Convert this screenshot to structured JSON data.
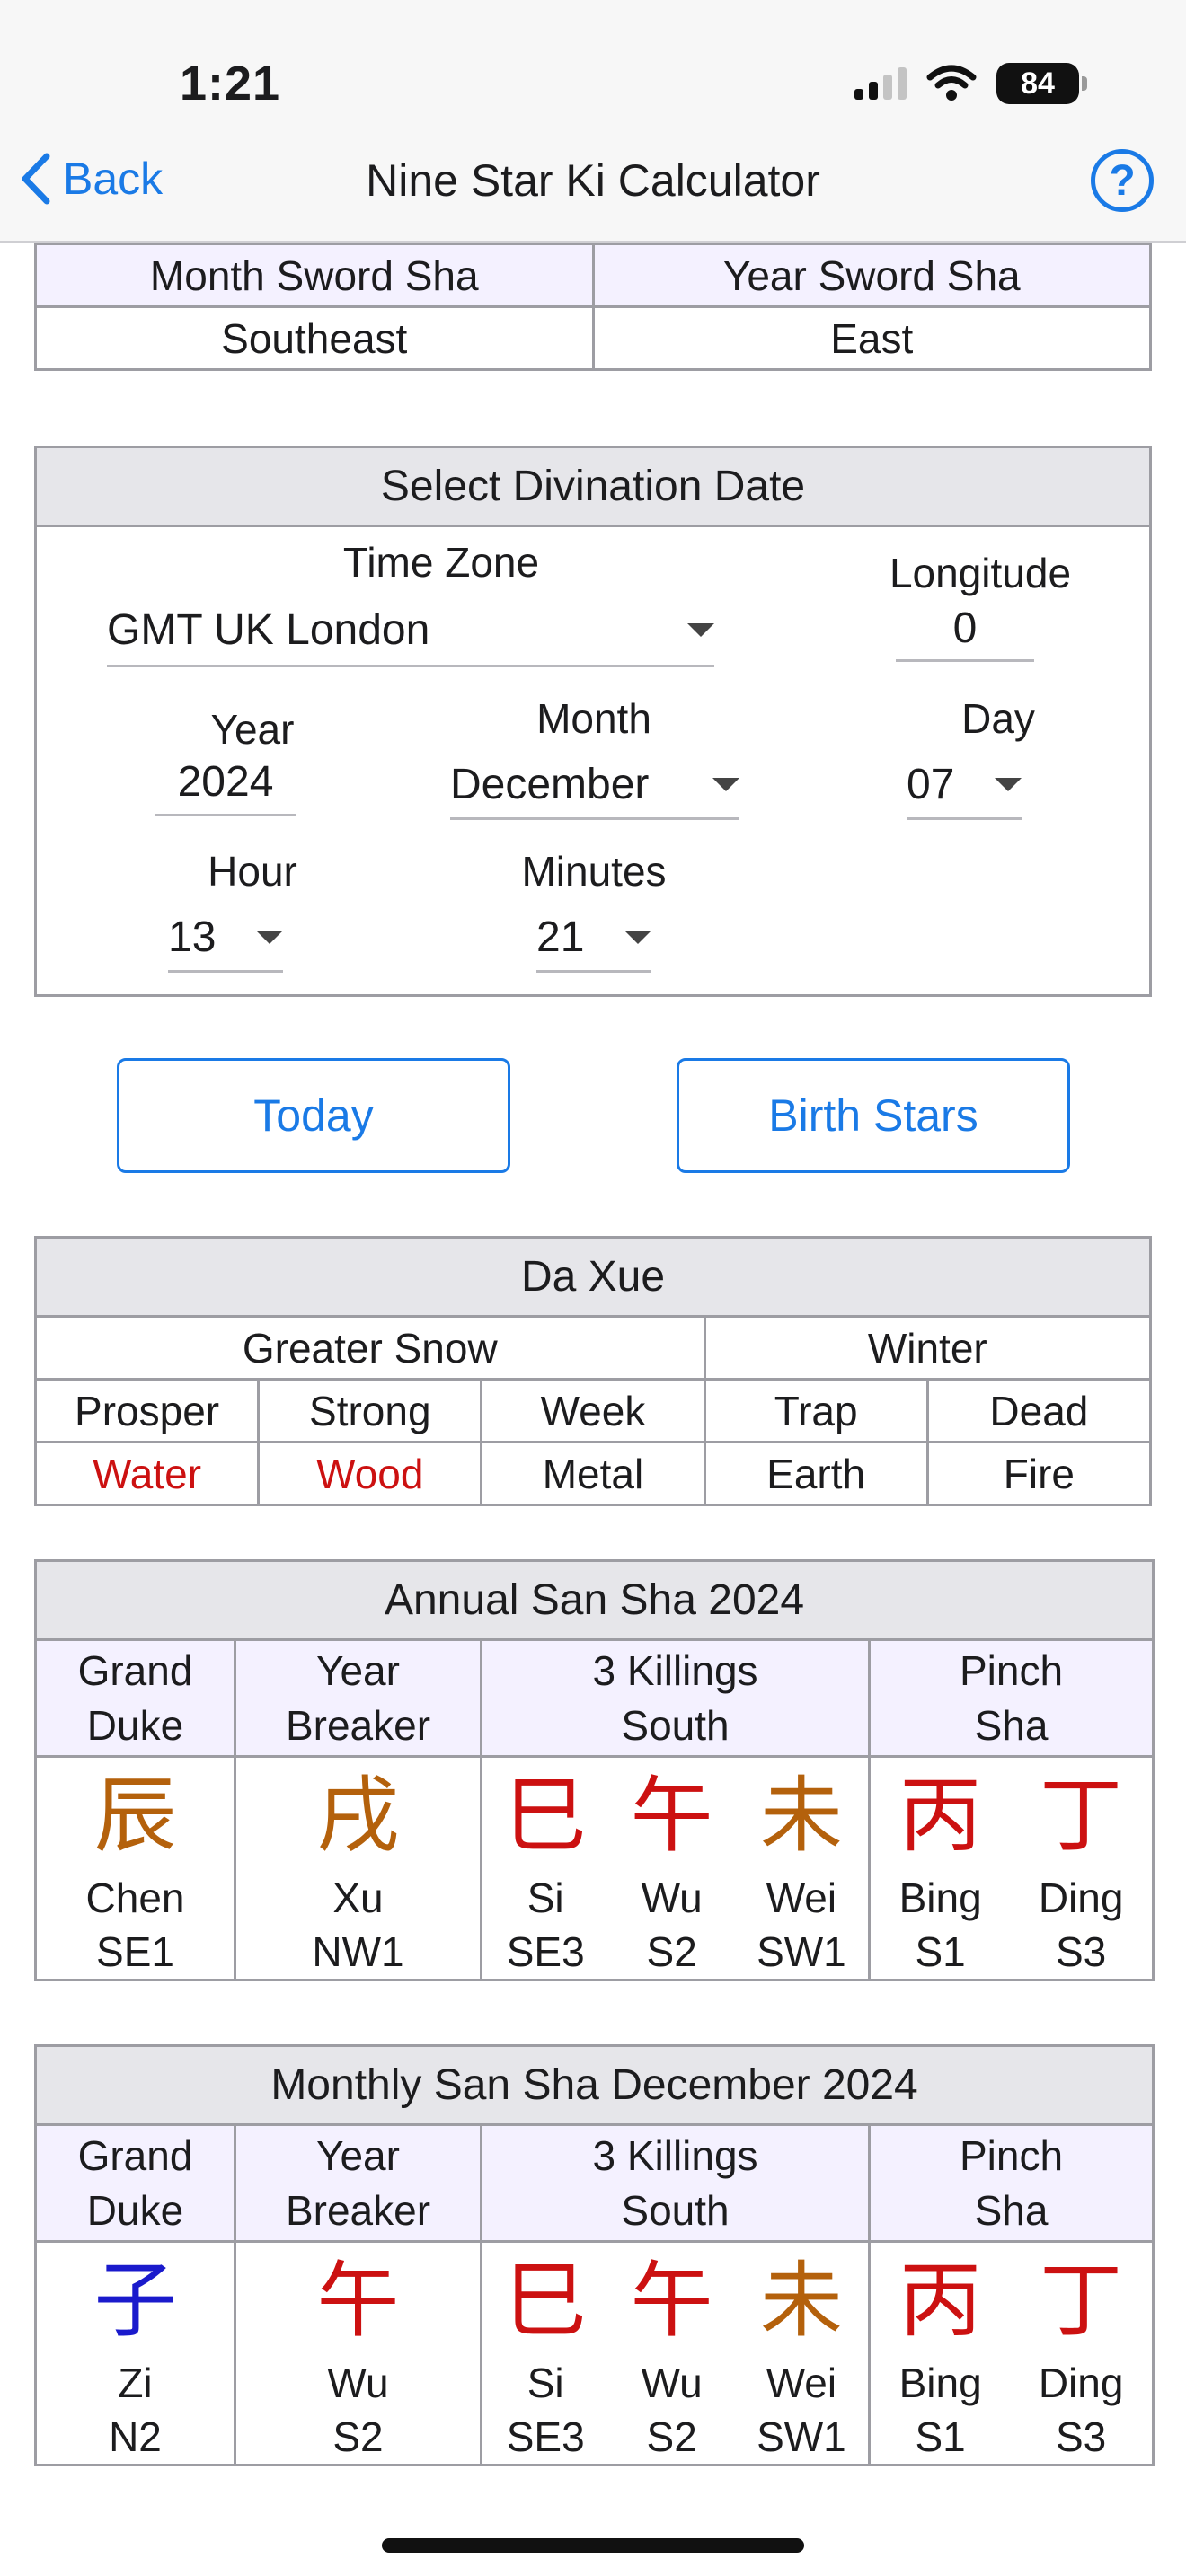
{
  "status": {
    "time": "1:21",
    "battery": "84"
  },
  "nav": {
    "back_label": "Back",
    "title": "Nine Star Ki Calculator",
    "help_label": "?"
  },
  "sword_sha": {
    "month_label": "Month Sword Sha",
    "year_label": "Year Sword Sha",
    "month_value": "Southeast",
    "year_value": "East"
  },
  "divination": {
    "title": "Select Divination Date",
    "timezone_label": "Time Zone",
    "timezone_value": "GMT UK London",
    "longitude_label": "Longitude",
    "longitude_value": "0",
    "year_label": "Year",
    "year_value": "2024",
    "month_label": "Month",
    "month_value": "December",
    "day_label": "Day",
    "day_value": "07",
    "hour_label": "Hour",
    "hour_value": "13",
    "minutes_label": "Minutes",
    "minutes_value": "21"
  },
  "buttons": {
    "today": "Today",
    "birth_stars": "Birth Stars"
  },
  "da_xue": {
    "title": "Da Xue",
    "season_left": "Greater Snow",
    "season_right": "Winter",
    "states": [
      "Prosper",
      "Strong",
      "Week",
      "Trap",
      "Dead"
    ],
    "elements": [
      "Water",
      "Wood",
      "Metal",
      "Earth",
      "Fire"
    ]
  },
  "annual": {
    "title": "Annual San Sha 2024",
    "headers": {
      "grand_duke_1": "Grand",
      "grand_duke_2": "Duke",
      "year_breaker_1": "Year",
      "year_breaker_2": "Breaker",
      "killings_1": "3 Killings",
      "killings_2": "South",
      "pinch_1": "Pinch",
      "pinch_2": "Sha"
    },
    "grand_duke": {
      "glyph": "辰",
      "name": "Chen",
      "dir": "SE1"
    },
    "year_breaker": {
      "glyph": "戌",
      "name": "Xu",
      "dir": "NW1"
    },
    "killings": [
      {
        "glyph": "巳",
        "name": "Si",
        "dir": "SE3"
      },
      {
        "glyph": "午",
        "name": "Wu",
        "dir": "S2"
      },
      {
        "glyph": "未",
        "name": "Wei",
        "dir": "SW1"
      }
    ],
    "pinch": [
      {
        "glyph": "丙",
        "name": "Bing",
        "dir": "S1"
      },
      {
        "glyph": "丁",
        "name": "Ding",
        "dir": "S3"
      }
    ]
  },
  "monthly": {
    "title": "Monthly San Sha December 2024",
    "headers": {
      "grand_duke_1": "Grand",
      "grand_duke_2": "Duke",
      "year_breaker_1": "Year",
      "year_breaker_2": "Breaker",
      "killings_1": "3 Killings",
      "killings_2": "South",
      "pinch_1": "Pinch",
      "pinch_2": "Sha"
    },
    "grand_duke": {
      "glyph": "子",
      "name": "Zi",
      "dir": "N2"
    },
    "year_breaker": {
      "glyph": "午",
      "name": "Wu",
      "dir": "S2"
    },
    "killings": [
      {
        "glyph": "巳",
        "name": "Si",
        "dir": "SE3"
      },
      {
        "glyph": "午",
        "name": "Wu",
        "dir": "S2"
      },
      {
        "glyph": "未",
        "name": "Wei",
        "dir": "SW1"
      }
    ],
    "pinch": [
      {
        "glyph": "丙",
        "name": "Bing",
        "dir": "S1"
      },
      {
        "glyph": "丁",
        "name": "Ding",
        "dir": "S3"
      }
    ]
  },
  "colors": {
    "accent": "#1a7ae6",
    "red": "#cc1111",
    "brown": "#b4610c",
    "blue": "#1a1acc"
  }
}
